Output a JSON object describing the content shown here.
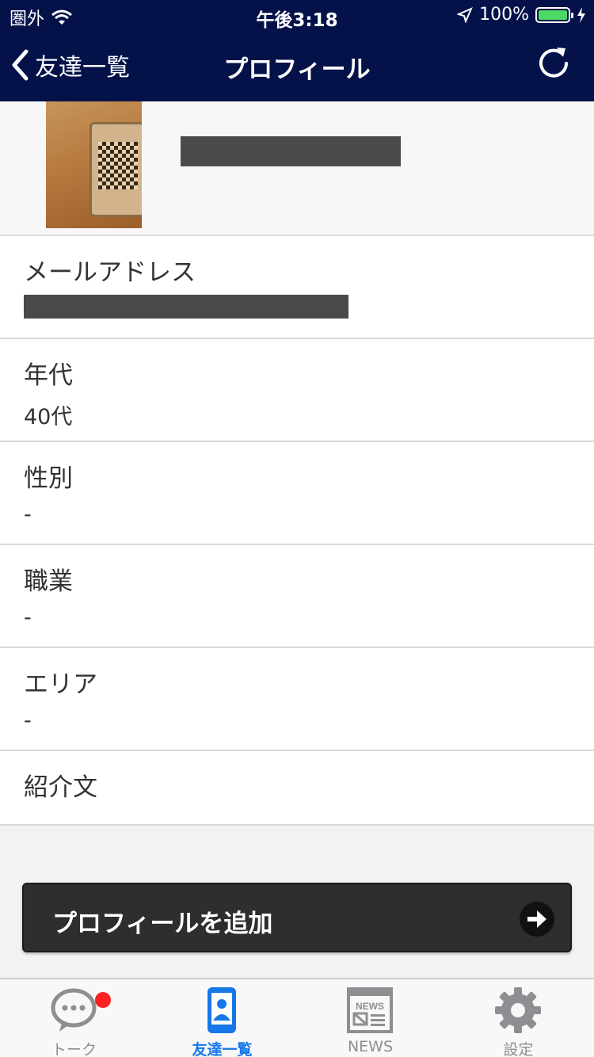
{
  "status_bar": {
    "carrier": "圏外",
    "time": "午後3:18",
    "battery": "100%"
  },
  "nav": {
    "back_label": "友達一覧",
    "title": "プロフィール"
  },
  "profile": {
    "rows": [
      {
        "label": "メールアドレス",
        "value": ""
      },
      {
        "label": "年代",
        "value": "40代"
      },
      {
        "label": "性別",
        "value": "-"
      },
      {
        "label": "職業",
        "value": "-"
      },
      {
        "label": "エリア",
        "value": "-"
      },
      {
        "label": "紹介文",
        "value": ""
      }
    ]
  },
  "add_button": {
    "label": "プロフィールを追加"
  },
  "tabs": [
    {
      "label": "トーク",
      "icon": "chat-bubble-icon",
      "badge": true
    },
    {
      "label": "友達一覧",
      "icon": "phone-person-icon",
      "active": true
    },
    {
      "label": "NEWS",
      "icon": "news-icon"
    },
    {
      "label": "設定",
      "icon": "gear-icon"
    }
  ],
  "colors": {
    "nav_bg": "#041249",
    "tab_active": "#1677e8",
    "battery": "#4cd964",
    "badge": "#ff2020"
  }
}
